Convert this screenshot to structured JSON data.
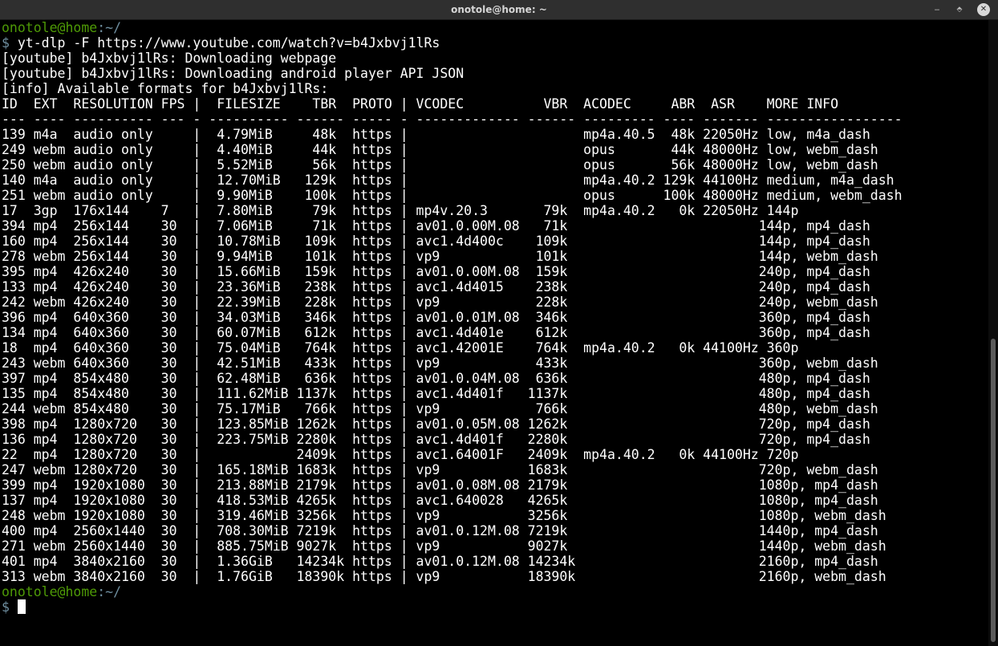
{
  "window": {
    "title": "onotole@home: ~",
    "minimize_glyph": "‒",
    "maximize_glyph": "⬘",
    "close_glyph": "✕"
  },
  "prompt": {
    "user_host": "onotole@home",
    "path": ":~/",
    "symbol": "$"
  },
  "command": "yt-dlp -F https://www.youtube.com/watch?v=b4Jxbvj1lRs",
  "output_lines": [
    "[youtube] b4Jxbvj1lRs: Downloading webpage",
    "[youtube] b4Jxbvj1lRs: Downloading android player API JSON",
    "[info] Available formats for b4Jxbvj1lRs:",
    "ID  EXT  RESOLUTION FPS |  FILESIZE    TBR  PROTO | VCODEC          VBR  ACODEC     ABR  ASR    MORE INFO",
    "--- ---- ---------- --- - ---------- ------ ----- - ------------- ------ --------- ---- ------- -----------------",
    "139 m4a  audio only     |  4.79MiB     48k  https |                      mp4a.40.5  48k 22050Hz low, m4a_dash",
    "249 webm audio only     |  4.40MiB     44k  https |                      opus       44k 48000Hz low, webm_dash",
    "250 webm audio only     |  5.52MiB     56k  https |                      opus       56k 48000Hz low, webm_dash",
    "140 m4a  audio only     |  12.70MiB   129k  https |                      mp4a.40.2 129k 44100Hz medium, m4a_dash",
    "251 webm audio only     |  9.90MiB    100k  https |                      opus      100k 48000Hz medium, webm_dash",
    "17  3gp  176x144    7   |  7.80MiB     79k  https | mp4v.20.3       79k  mp4a.40.2   0k 22050Hz 144p",
    "394 mp4  256x144    30  |  7.06MiB     71k  https | av01.0.00M.08   71k                        144p, mp4_dash",
    "160 mp4  256x144    30  |  10.78MiB   109k  https | avc1.4d400c    109k                        144p, mp4_dash",
    "278 webm 256x144    30  |  9.94MiB    101k  https | vp9            101k                        144p, webm_dash",
    "395 mp4  426x240    30  |  15.66MiB   159k  https | av01.0.00M.08  159k                        240p, mp4_dash",
    "133 mp4  426x240    30  |  23.36MiB   238k  https | avc1.4d4015    238k                        240p, mp4_dash",
    "242 webm 426x240    30  |  22.39MiB   228k  https | vp9            228k                        240p, webm_dash",
    "396 mp4  640x360    30  |  34.03MiB   346k  https | av01.0.01M.08  346k                        360p, mp4_dash",
    "134 mp4  640x360    30  |  60.07MiB   612k  https | avc1.4d401e    612k                        360p, mp4_dash",
    "18  mp4  640x360    30  |  75.04MiB   764k  https | avc1.42001E    764k  mp4a.40.2   0k 44100Hz 360p",
    "243 webm 640x360    30  |  42.51MiB   433k  https | vp9            433k                        360p, webm_dash",
    "397 mp4  854x480    30  |  62.48MiB   636k  https | av01.0.04M.08  636k                        480p, mp4_dash",
    "135 mp4  854x480    30  |  111.62MiB 1137k  https | avc1.4d401f   1137k                        480p, mp4_dash",
    "244 webm 854x480    30  |  75.17MiB   766k  https | vp9            766k                        480p, webm_dash",
    "398 mp4  1280x720   30  |  123.85MiB 1262k  https | av01.0.05M.08 1262k                        720p, mp4_dash",
    "136 mp4  1280x720   30  |  223.75MiB 2280k  https | avc1.4d401f   2280k                        720p, mp4_dash",
    "22  mp4  1280x720   30  |            2409k  https | avc1.64001F   2409k  mp4a.40.2   0k 44100Hz 720p",
    "247 webm 1280x720   30  |  165.18MiB 1683k  https | vp9           1683k                        720p, webm_dash",
    "399 mp4  1920x1080  30  |  213.88MiB 2179k  https | av01.0.08M.08 2179k                        1080p, mp4_dash",
    "137 mp4  1920x1080  30  |  418.53MiB 4265k  https | avc1.640028   4265k                        1080p, mp4_dash",
    "248 webm 1920x1080  30  |  319.46MiB 3256k  https | vp9           3256k                        1080p, webm_dash",
    "400 mp4  2560x1440  30  |  708.30MiB 7219k  https | av01.0.12M.08 7219k                        1440p, mp4_dash",
    "271 webm 2560x1440  30  |  885.75MiB 9027k  https | vp9           9027k                        1440p, webm_dash",
    "401 mp4  3840x2160  30  |  1.36GiB   14234k https | av01.0.12M.08 14234k                       2160p, mp4_dash",
    "313 webm 3840x2160  30  |  1.76GiB   18390k https | vp9           18390k                       2160p, webm_dash"
  ]
}
